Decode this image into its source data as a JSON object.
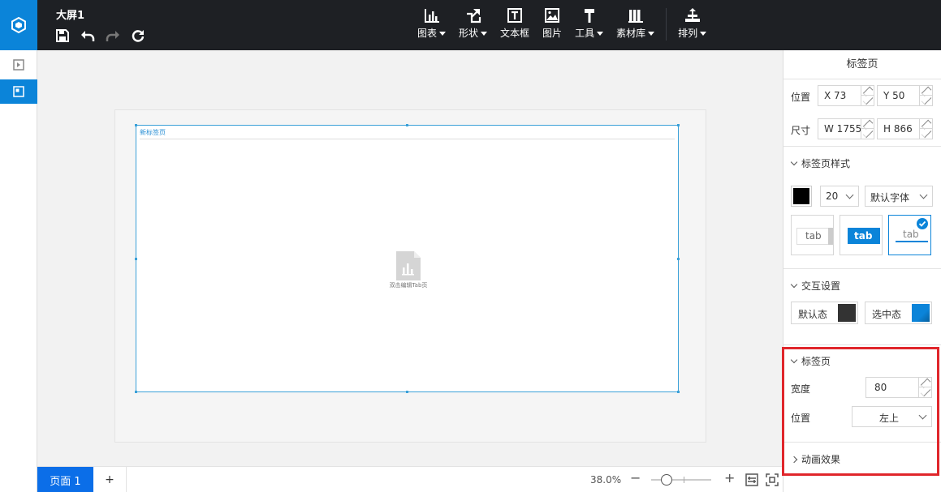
{
  "app": {
    "doc_title": "大屏1"
  },
  "toolbar": {
    "tools": [
      {
        "label": "图表",
        "icon": "bar-chart-icon",
        "dropdown": true
      },
      {
        "label": "形状",
        "icon": "shape-icon",
        "dropdown": true
      },
      {
        "label": "文本框",
        "icon": "textbox-icon",
        "dropdown": false
      },
      {
        "label": "图片",
        "icon": "image-icon",
        "dropdown": false
      },
      {
        "label": "工具",
        "icon": "hammer-icon",
        "dropdown": true
      },
      {
        "label": "素材库",
        "icon": "library-icon",
        "dropdown": true
      },
      {
        "label": "排列",
        "icon": "arrange-icon",
        "dropdown": true
      }
    ]
  },
  "canvas": {
    "tab_label": "新标签页",
    "placeholder_text": "双击编辑Tab页"
  },
  "bottombar": {
    "page_tab": "页面 1",
    "add": "+",
    "zoom": "38.0%",
    "zoom_level": 0.38,
    "minus": "−",
    "plus": "+"
  },
  "panel": {
    "title": "标签页",
    "position_label": "位置",
    "x": "X 73",
    "y": "Y 50",
    "size_label": "尺寸",
    "w": "W 1755",
    "h": "H 866",
    "style_section": "标签页样式",
    "font_color": "#000000",
    "font_size": "20",
    "font_family": "默认字体",
    "style_cards": [
      "tab",
      "tab",
      "tab"
    ],
    "interaction_section": "交互设置",
    "default_state": "默认态",
    "default_color": "#333333",
    "selected_state": "选中态",
    "selected_color": "#0b84d9",
    "tab_section": "标签页",
    "width_label": "宽度",
    "width_value": "80",
    "pos_label": "位置",
    "pos_value": "左上",
    "anim_section": "动画效果"
  },
  "colors": {
    "accent": "#0b84d9",
    "topbar": "#1e2024",
    "page_tab": "#0b6ee8",
    "highlight": "#e0262b"
  }
}
